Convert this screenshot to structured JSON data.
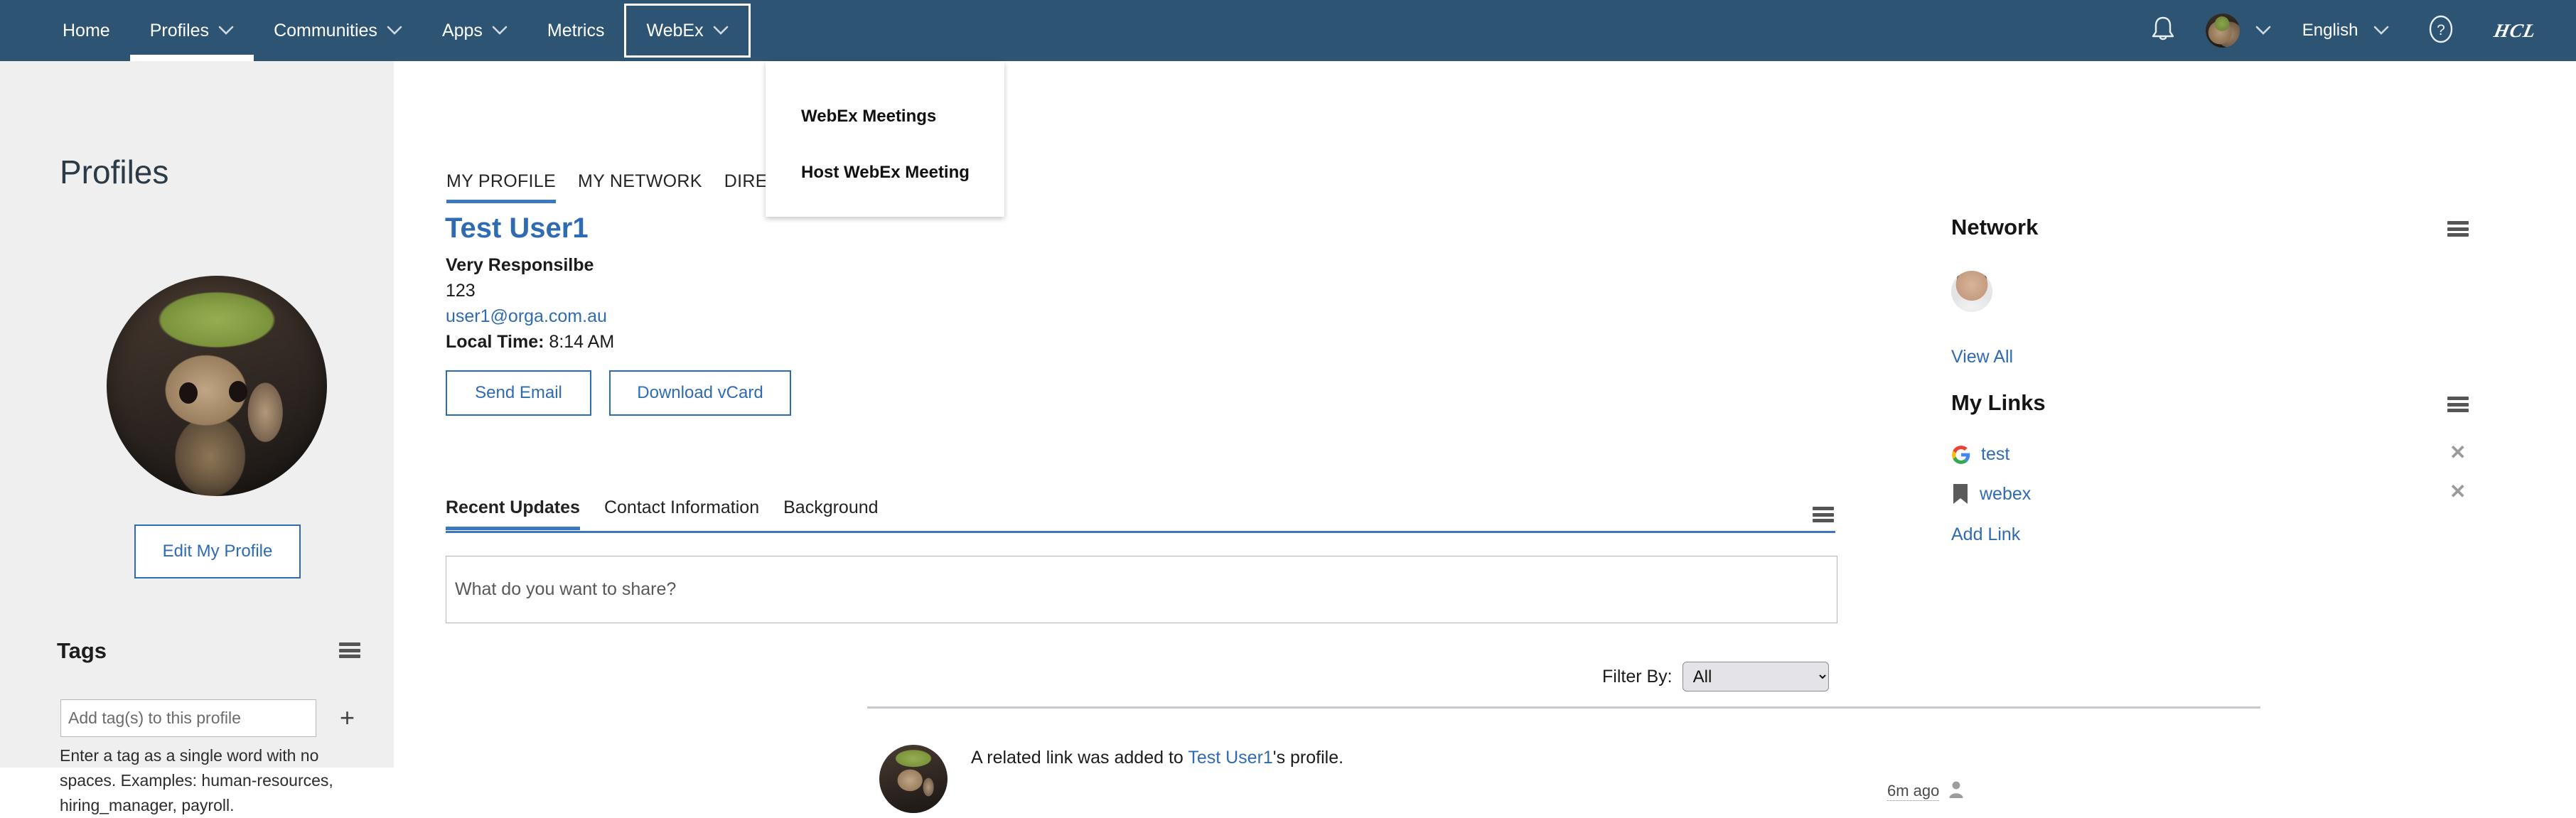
{
  "theme": {
    "nav_bg": "#2d5472",
    "accent": "#2f6bb3",
    "tab_underline": "#3b78c3",
    "rail_bg": "#efefef"
  },
  "topnav": {
    "items": [
      {
        "label": "Home",
        "has_caret": false,
        "active": false
      },
      {
        "label": "Profiles",
        "has_caret": true,
        "active": true
      },
      {
        "label": "Communities",
        "has_caret": true,
        "active": false
      },
      {
        "label": "Apps",
        "has_caret": true,
        "active": false
      },
      {
        "label": "Metrics",
        "has_caret": false,
        "active": false
      },
      {
        "label": "WebEx",
        "has_caret": true,
        "active": false,
        "boxed": true
      }
    ],
    "bell_icon": "bell-icon",
    "user_avatar_icon": "user-avatar",
    "user_caret_icon": "chevron-down-icon",
    "language": "English",
    "language_caret_icon": "chevron-down-icon",
    "help_icon": "help-question-icon",
    "brand": "HCL"
  },
  "webex_dropdown": {
    "items": [
      {
        "label": "WebEx Meetings"
      },
      {
        "label": "Host WebEx Meeting"
      }
    ]
  },
  "left_rail": {
    "title": "Profiles",
    "avatar_icon": "profile-photo",
    "edit_button": "Edit My Profile",
    "tags": {
      "heading": "Tags",
      "menu_icon": "hamburger-icon",
      "input_placeholder": "Add tag(s) to this profile",
      "input_value": "",
      "add_icon": "plus-icon",
      "hint": "Enter a tag as a single word with no spaces. Examples: human-resources, hiring_manager, payroll."
    }
  },
  "main": {
    "top_tabs": [
      {
        "label": "MY PROFILE",
        "active": true
      },
      {
        "label": "MY NETWORK",
        "active": false
      },
      {
        "label": "DIRECTORY",
        "active": false
      }
    ],
    "profile": {
      "name": "Test User1",
      "title": "Very Responsilbe",
      "phone": "123",
      "email": "user1@orga.com.au",
      "local_time_label": "Local Time:",
      "local_time_value": "8:14 AM",
      "send_email_button": "Send Email",
      "download_vcard_button": "Download vCard"
    },
    "sub_tabs": [
      {
        "label": "Recent Updates",
        "active": true
      },
      {
        "label": "Contact Information",
        "active": false
      },
      {
        "label": "Background",
        "active": false
      }
    ],
    "sub_tabs_menu_icon": "hamburger-icon",
    "share": {
      "placeholder": "What do you want to share?",
      "value": ""
    },
    "filter": {
      "label": "Filter By:",
      "selected": "All",
      "options": [
        "All"
      ]
    },
    "feed": [
      {
        "avatar_icon": "profile-photo",
        "text_before": "A related link was added to ",
        "link_text": "Test User1",
        "text_after": "'s profile.",
        "time": "6m ago",
        "visibility_icon": "person-icon"
      }
    ]
  },
  "right_rail": {
    "network": {
      "heading": "Network",
      "menu_icon": "hamburger-icon",
      "member_avatar_icon": "person-photo",
      "view_all": "View All"
    },
    "my_links": {
      "heading": "My Links",
      "menu_icon": "hamburger-icon",
      "items": [
        {
          "label": "test",
          "icon": "google-icon",
          "remove_icon": "close-icon"
        },
        {
          "label": "webex",
          "icon": "bookmark-icon",
          "remove_icon": "close-icon"
        }
      ],
      "add_link": "Add Link"
    }
  }
}
